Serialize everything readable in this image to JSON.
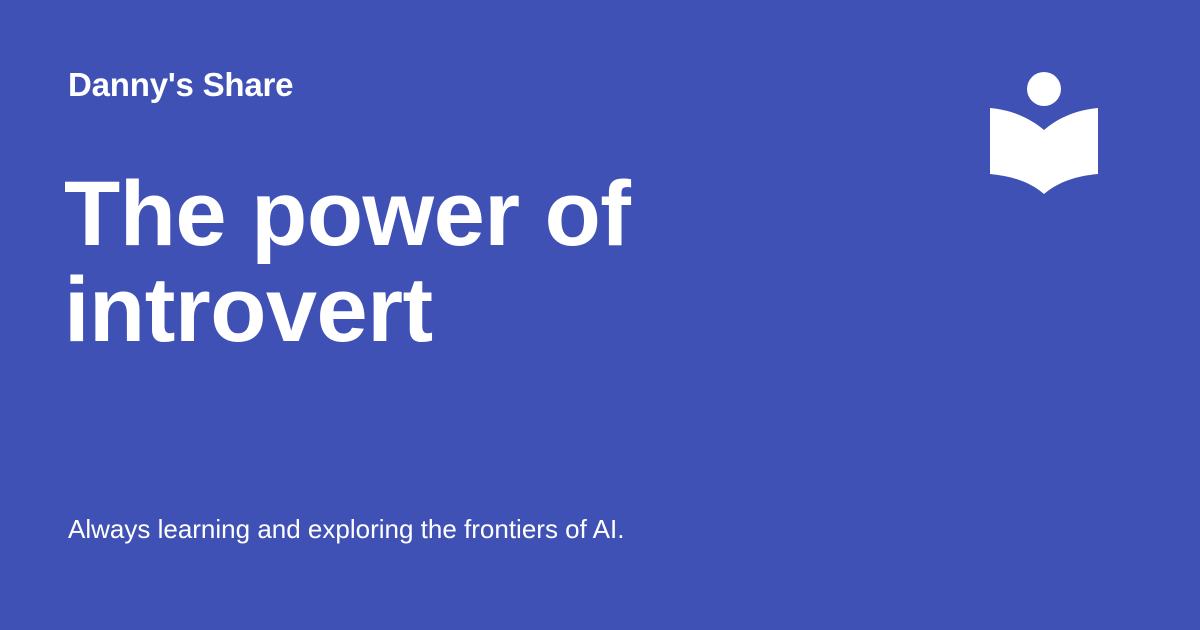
{
  "page": {
    "background_color": "#3f51b5",
    "text_color": "#ffffff"
  },
  "header": {
    "site_name": "Danny's Share",
    "logo_icon": "reader-book-icon"
  },
  "main": {
    "title_lines": [
      "The power of",
      "introvert"
    ]
  },
  "footer": {
    "tagline": "Always learning and exploring the frontiers of AI."
  }
}
